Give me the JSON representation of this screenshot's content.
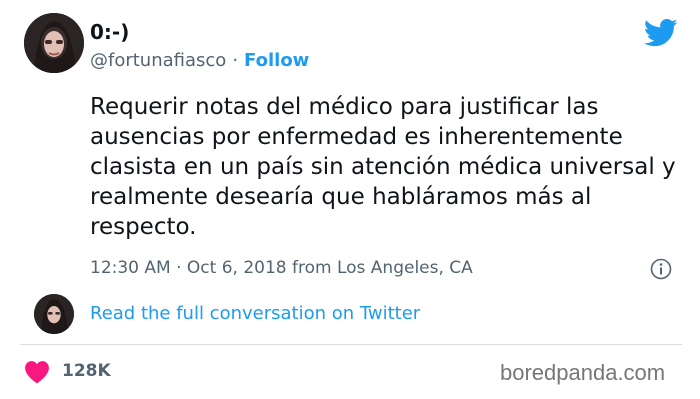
{
  "author": {
    "display_name": "0:-)",
    "handle": "@fortunafiasco",
    "separator": "·",
    "follow_label": "Follow"
  },
  "tweet": {
    "text": "Requerir notas del médico para justificar las ausencias por enfermedad es inherentemente clasista en un país sin atención médica universal y realmente desearía que habláramos más al respecto.",
    "timestamp": "12:30 AM · Oct 6, 2018 from Los Angeles, CA"
  },
  "conversation": {
    "link_label": "Read the full conversation on Twitter"
  },
  "engagement": {
    "likes": "128K"
  },
  "watermark": "boredpanda.com",
  "colors": {
    "accent": "#1d9bf0",
    "heart": "#f91880",
    "text": "#0f1419",
    "muted": "#536471"
  },
  "icons": {
    "logo": "twitter-bird-icon",
    "info": "info-icon",
    "like": "heart-icon"
  }
}
